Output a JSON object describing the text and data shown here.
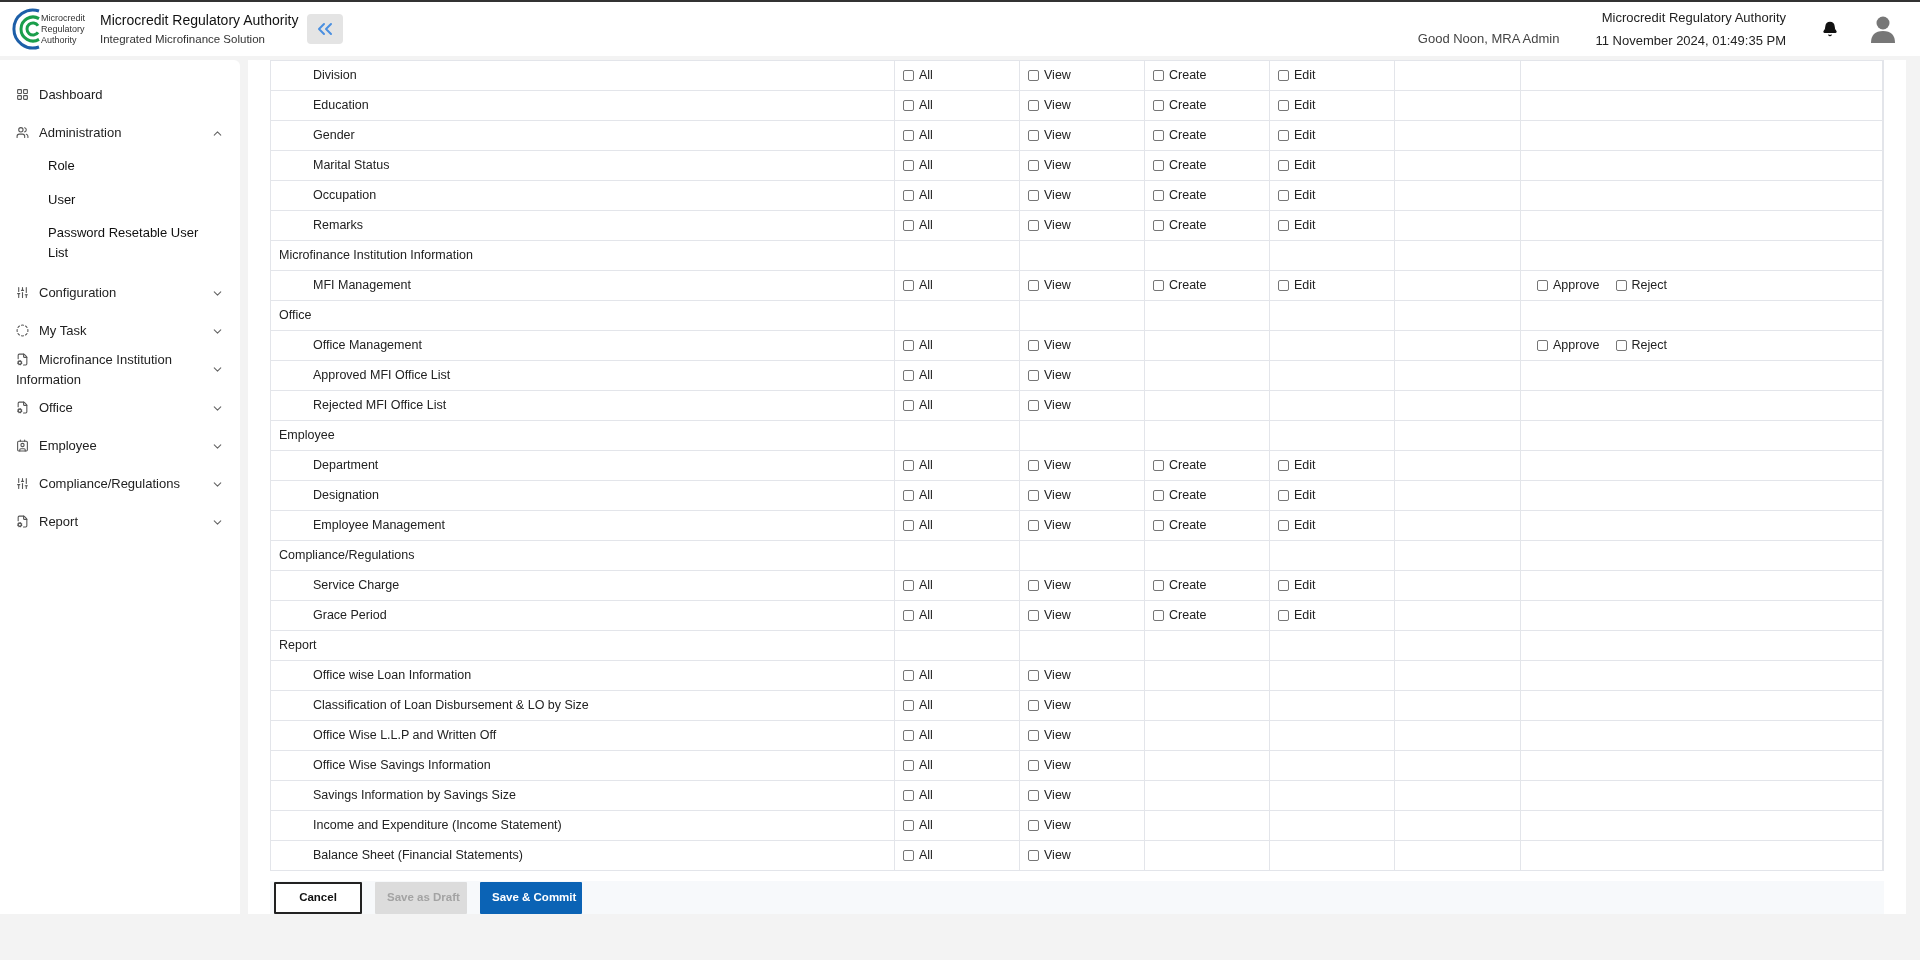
{
  "header": {
    "org_name": "Microcredit Regulatory Authority",
    "product": "Integrated Microfinance Solution",
    "logo_text": [
      "Microcredit",
      "Regulatory",
      "Authority"
    ],
    "greeting": "Good Noon, MRA Admin",
    "authority": "Microcredit Regulatory Authority",
    "datetime": "11 November 2024, 01:49:35 PM"
  },
  "sidebar": {
    "items": [
      {
        "label": "Dashboard",
        "kind": "link"
      },
      {
        "label": "Administration",
        "kind": "menu",
        "expanded": true,
        "children": [
          {
            "label": "Role"
          },
          {
            "label": "User"
          },
          {
            "label": "Password Resetable User List"
          }
        ]
      },
      {
        "label": "Configuration",
        "kind": "menu",
        "expanded": false
      },
      {
        "label": "My Task",
        "kind": "menu",
        "expanded": false
      },
      {
        "label": "Microfinance Institution Information",
        "kind": "menu",
        "expanded": false
      },
      {
        "label": "Office",
        "kind": "menu",
        "expanded": false
      },
      {
        "label": "Employee",
        "kind": "menu",
        "expanded": false
      },
      {
        "label": "Compliance/Regulations",
        "kind": "menu",
        "expanded": false
      },
      {
        "label": "Report",
        "kind": "menu",
        "expanded": false
      }
    ]
  },
  "table": {
    "rows": [
      {
        "kind": "item",
        "label": "Division",
        "all": {
          "label": "All",
          "checked": false
        },
        "view": {
          "label": "View",
          "checked": false
        },
        "create": {
          "label": "Create",
          "checked": false
        },
        "edit": {
          "label": "Edit",
          "checked": false
        }
      },
      {
        "kind": "item",
        "label": "Education",
        "all": {
          "label": "All",
          "checked": false
        },
        "view": {
          "label": "View",
          "checked": false
        },
        "create": {
          "label": "Create",
          "checked": false
        },
        "edit": {
          "label": "Edit",
          "checked": false
        }
      },
      {
        "kind": "item",
        "label": "Gender",
        "all": {
          "label": "All",
          "checked": false
        },
        "view": {
          "label": "View",
          "checked": false
        },
        "create": {
          "label": "Create",
          "checked": false
        },
        "edit": {
          "label": "Edit",
          "checked": false
        }
      },
      {
        "kind": "item",
        "label": "Marital Status",
        "all": {
          "label": "All",
          "checked": false
        },
        "view": {
          "label": "View",
          "checked": false
        },
        "create": {
          "label": "Create",
          "checked": false
        },
        "edit": {
          "label": "Edit",
          "checked": false
        }
      },
      {
        "kind": "item",
        "label": "Occupation",
        "all": {
          "label": "All",
          "checked": false
        },
        "view": {
          "label": "View",
          "checked": false
        },
        "create": {
          "label": "Create",
          "checked": false
        },
        "edit": {
          "label": "Edit",
          "checked": false
        }
      },
      {
        "kind": "item",
        "label": "Remarks",
        "all": {
          "label": "All",
          "checked": false
        },
        "view": {
          "label": "View",
          "checked": false
        },
        "create": {
          "label": "Create",
          "checked": false
        },
        "edit": {
          "label": "Edit",
          "checked": false
        }
      },
      {
        "kind": "group",
        "label": "Microfinance Institution Information"
      },
      {
        "kind": "item",
        "label": "MFI Management",
        "all": {
          "label": "All",
          "checked": false
        },
        "view": {
          "label": "View",
          "checked": false
        },
        "create": {
          "label": "Create",
          "checked": false
        },
        "edit": {
          "label": "Edit",
          "checked": false
        },
        "decisions": [
          {
            "label": "Approve",
            "checked": false
          },
          {
            "label": "Reject",
            "checked": false
          }
        ]
      },
      {
        "kind": "group",
        "label": "Office"
      },
      {
        "kind": "item",
        "label": "Office Management",
        "all": {
          "label": "All",
          "checked": false
        },
        "view": {
          "label": "View",
          "checked": false
        },
        "decisions": [
          {
            "label": "Approve",
            "checked": false
          },
          {
            "label": "Reject",
            "checked": false
          }
        ]
      },
      {
        "kind": "item",
        "label": "Approved MFI Office List",
        "all": {
          "label": "All",
          "checked": false
        },
        "view": {
          "label": "View",
          "checked": false
        }
      },
      {
        "kind": "item",
        "label": "Rejected MFI Office List",
        "all": {
          "label": "All",
          "checked": false
        },
        "view": {
          "label": "View",
          "checked": false
        }
      },
      {
        "kind": "group",
        "label": "Employee"
      },
      {
        "kind": "item",
        "label": "Department",
        "all": {
          "label": "All",
          "checked": false
        },
        "view": {
          "label": "View",
          "checked": false
        },
        "create": {
          "label": "Create",
          "checked": false
        },
        "edit": {
          "label": "Edit",
          "checked": false
        }
      },
      {
        "kind": "item",
        "label": "Designation",
        "all": {
          "label": "All",
          "checked": false
        },
        "view": {
          "label": "View",
          "checked": false
        },
        "create": {
          "label": "Create",
          "checked": false
        },
        "edit": {
          "label": "Edit",
          "checked": false
        }
      },
      {
        "kind": "item",
        "label": "Employee Management",
        "all": {
          "label": "All",
          "checked": false
        },
        "view": {
          "label": "View",
          "checked": false
        },
        "create": {
          "label": "Create",
          "checked": false
        },
        "edit": {
          "label": "Edit",
          "checked": false
        }
      },
      {
        "kind": "group",
        "label": "Compliance/Regulations"
      },
      {
        "kind": "item",
        "label": "Service Charge",
        "all": {
          "label": "All",
          "checked": false
        },
        "view": {
          "label": "View",
          "checked": false
        },
        "create": {
          "label": "Create",
          "checked": false
        },
        "edit": {
          "label": "Edit",
          "checked": false
        }
      },
      {
        "kind": "item",
        "label": "Grace Period",
        "all": {
          "label": "All",
          "checked": false
        },
        "view": {
          "label": "View",
          "checked": false
        },
        "create": {
          "label": "Create",
          "checked": false
        },
        "edit": {
          "label": "Edit",
          "checked": false
        }
      },
      {
        "kind": "group",
        "label": "Report"
      },
      {
        "kind": "item",
        "label": "Office wise Loan Information",
        "all": {
          "label": "All",
          "checked": false
        },
        "view": {
          "label": "View",
          "checked": false
        }
      },
      {
        "kind": "item",
        "label": "Classification of Loan Disbursement & LO by Size",
        "all": {
          "label": "All",
          "checked": false
        },
        "view": {
          "label": "View",
          "checked": false
        }
      },
      {
        "kind": "item",
        "label": "Office Wise L.L.P and Written Off",
        "all": {
          "label": "All",
          "checked": false
        },
        "view": {
          "label": "View",
          "checked": false
        }
      },
      {
        "kind": "item",
        "label": "Office Wise Savings Information",
        "all": {
          "label": "All",
          "checked": false
        },
        "view": {
          "label": "View",
          "checked": false
        }
      },
      {
        "kind": "item",
        "label": "Savings Information by Savings Size",
        "all": {
          "label": "All",
          "checked": false
        },
        "view": {
          "label": "View",
          "checked": false
        }
      },
      {
        "kind": "item",
        "label": "Income and Expenditure (Income Statement)",
        "all": {
          "label": "All",
          "checked": false
        },
        "view": {
          "label": "View",
          "checked": false
        }
      },
      {
        "kind": "item",
        "label": "Balance Sheet (Financial Statements)",
        "all": {
          "label": "All",
          "checked": false
        },
        "view": {
          "label": "View",
          "checked": false
        }
      }
    ]
  },
  "actions": [
    {
      "label": "Cancel",
      "kind": "outline",
      "disabled": false
    },
    {
      "label": "Save as Draft",
      "kind": "secondary",
      "disabled": true
    },
    {
      "label": "Save & Commit",
      "kind": "primary",
      "disabled": false
    }
  ]
}
